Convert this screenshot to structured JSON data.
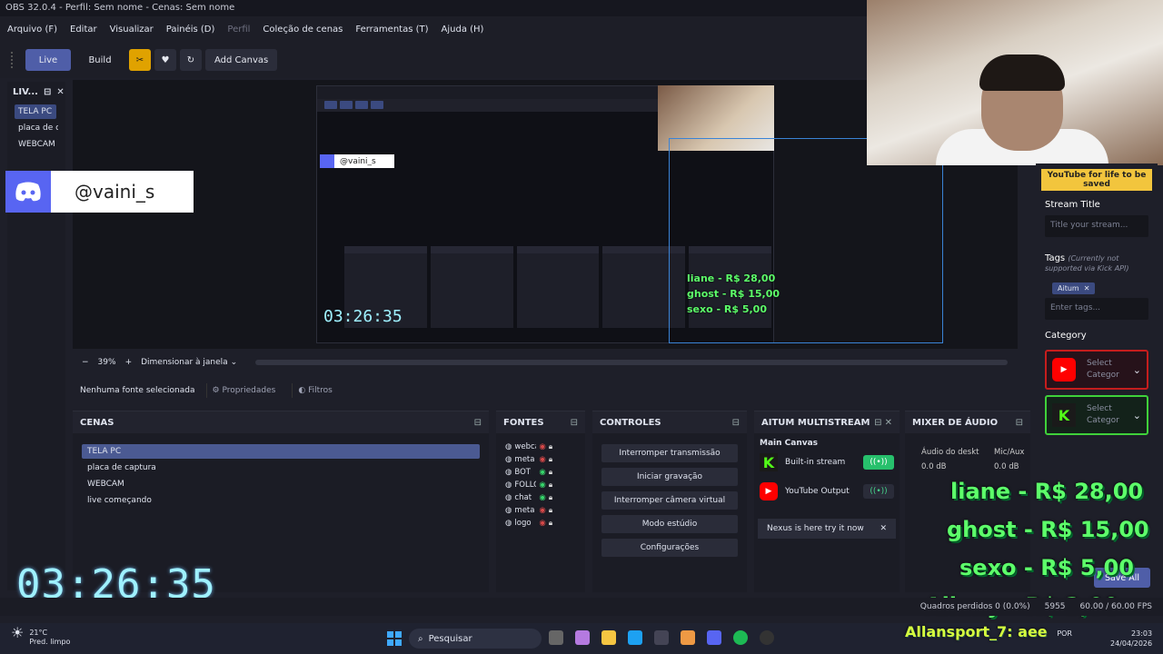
{
  "title": "OBS 32.0.4 - Perfil: Sem nome - Cenas: Sem nome",
  "menu": [
    "Arquivo (F)",
    "Editar",
    "Visualizar",
    "Painéis (D)",
    "Perfil",
    "Coleção de cenas",
    "Ferramentas (T)",
    "Ajuda (H)"
  ],
  "toolbar": {
    "live": "Live",
    "build": "Build",
    "add_canvas": "Add Canvas"
  },
  "left_panel": {
    "title": "LIV...",
    "items": [
      "TELA PC",
      "placa de ca",
      "WEBCAM"
    ]
  },
  "overlay": {
    "discord_name": "@vaini_s",
    "clock": "03:26:35"
  },
  "nested": {
    "discord_name": "@vaini_s",
    "clock": "03:26:35"
  },
  "zoom": {
    "minus": "−",
    "value": "39%",
    "plus": "+",
    "mode": "Dimensionar à janela"
  },
  "source_bar": {
    "none": "Nenhuma fonte selecionada",
    "props": "Propriedades",
    "filters": "Filtros"
  },
  "scenes": {
    "title": "CENAS",
    "items": [
      "TELA PC",
      "placa de captura",
      "WEBCAM",
      "live começando"
    ]
  },
  "sources": {
    "title": "FONTES",
    "items": [
      {
        "name": "webca",
        "visible": false
      },
      {
        "name": "meta",
        "visible": false
      },
      {
        "name": "BOT",
        "visible": true
      },
      {
        "name": "FOLLO",
        "visible": true
      },
      {
        "name": "chat",
        "visible": true
      },
      {
        "name": "meta",
        "visible": false
      },
      {
        "name": "logo",
        "visible": false
      }
    ]
  },
  "controls": {
    "title": "CONTROLES",
    "buttons": [
      "Interromper transmissão",
      "Iniciar gravação",
      "Interromper câmera virtual",
      "Modo estúdio",
      "Configurações"
    ]
  },
  "altium": {
    "title": "AITUM MULTISTREAM",
    "canvas": "Main Canvas",
    "builtin": "Built-in stream",
    "youtube": "YouTube Output",
    "nexus": "Nexus is here try it now"
  },
  "mixer": {
    "title": "MIXER DE ÁUDIO",
    "ch1": "Áudio do deskt",
    "ch2": "Mic/Aux",
    "db1": "0.0 dB",
    "db2": "0.0 dB"
  },
  "stream": {
    "warn": "YouTube for life to be saved",
    "title_label": "Stream Title",
    "title_placeholder": "Title your stream...",
    "tags_label": "Tags",
    "tags_note": "(Currently not supported via Kick API)",
    "tag": "Aitum",
    "tags_placeholder": "Enter tags...",
    "category_label": "Category",
    "select_category": "Select Categor",
    "save": "Save All"
  },
  "donations": [
    "liane - R$ 28,00",
    "ghost - R$ 15,00",
    "sexo - R$ 5,00",
    "Allany - R$ 3,00"
  ],
  "nested_donations": [
    "liane - R$ 28,00",
    "ghost - R$ 15,00",
    "sexo - R$ 5,00"
  ],
  "status": {
    "frames": "Quadros perdidos 0 (0.0%)",
    "kbps": "5955",
    "fps": "60.00 / 60.00 FPS"
  },
  "chat_overlay": "Allansport_7: aee",
  "taskbar": {
    "temp": "21°C",
    "weather": "Pred. limpo",
    "search": "Pesquisar",
    "lang": "POR",
    "time": "23:03",
    "date": "24/04/2026"
  },
  "colors": {
    "accent": "#4f5ea8",
    "donation": "#5dff6a",
    "kick": "#53fc18",
    "youtube": "#ff0000",
    "clock": "#9ff1ff"
  }
}
